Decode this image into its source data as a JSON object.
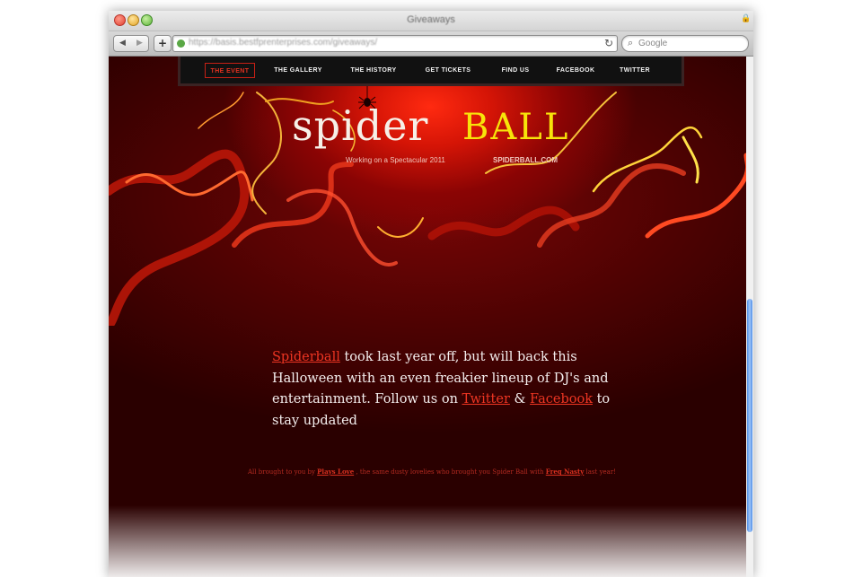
{
  "browser": {
    "window_title": "Giveaways",
    "url": "https://basis.bestfprenterprises.com/giveaways/",
    "search_placeholder": "Google",
    "back_label": "◀",
    "forward_label": "▶",
    "add_label": "+"
  },
  "nav": {
    "items": [
      {
        "label": "THE EVENT",
        "active": true
      },
      {
        "label": "THE GALLERY",
        "active": false
      },
      {
        "label": "THE HISTORY",
        "active": false
      },
      {
        "label": "GET TICKETS",
        "active": false
      },
      {
        "label": "FIND US",
        "active": false
      },
      {
        "label": "FACEBOOK",
        "active": false
      },
      {
        "label": "TWITTER",
        "active": false
      }
    ]
  },
  "header": {
    "logo_part1": "spider",
    "logo_part2": "BALL",
    "tagline": "Working on a Spectacular 2011",
    "domain": "SPIDERBALL.COM"
  },
  "main": {
    "link_spiderball": "Spiderball",
    "text_1": " took last year off, but will back this Halloween with an even freakier lineup of DJ's and entertainment. Follow us on ",
    "link_twitter": "Twitter",
    "text_2": " & ",
    "link_facebook": "Facebook",
    "text_3": " to stay updated"
  },
  "footer": {
    "text_1": "All brought to you by ",
    "link_plays_love": "Plays Love",
    "text_2": " , the same dusty lovelies who brought you Spider Ball with ",
    "link_freq_nasty": "Freq Nasty",
    "text_3": " last year!"
  },
  "colors": {
    "accent_red": "#ee3522",
    "logo_yellow": "#f7e40a",
    "nav_bg": "#111111"
  }
}
